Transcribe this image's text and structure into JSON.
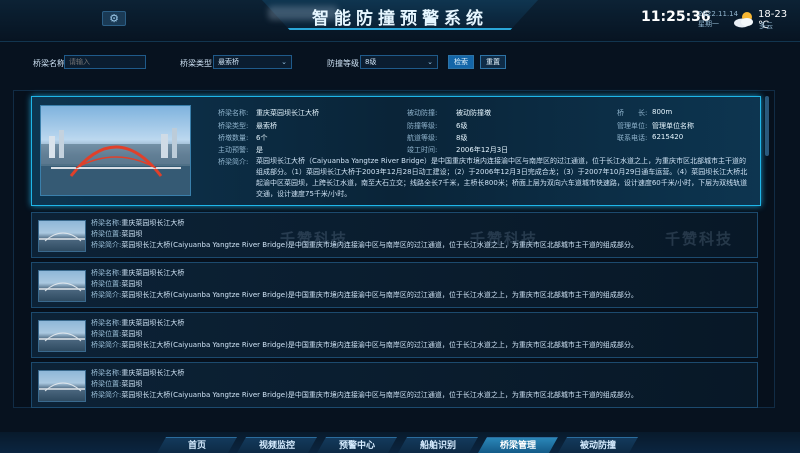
{
  "header": {
    "title": "智能防撞预警系统",
    "time": "11:25:36",
    "date": "2022.11.14",
    "weekday": "星期一",
    "temperature": "18-23 ℃",
    "weather": "多云",
    "settings_icon": "gear-icon",
    "weather_icon": "cloudy-sun-icon"
  },
  "search": {
    "name_label": "桥梁名称",
    "name_placeholder": "请输入",
    "type_label": "桥梁类型",
    "type_value": "悬索桥",
    "level_label": "防撞等级",
    "level_value": "8级",
    "search_button": "检索",
    "reset_button": "重置"
  },
  "featured": {
    "name_label": "桥梁名称:",
    "name": "重庆菜园坝长江大桥",
    "type_label": "桥梁类型:",
    "type": "悬索桥",
    "piers_label": "桥墩数量:",
    "piers": "6个",
    "alert_label": "主动预警:",
    "alert": "是",
    "defense_label": "被动防撞:",
    "defense": "被动防撞墩",
    "level_label": "防撞等级:",
    "level": "6级",
    "channel_label": "航道等级:",
    "channel": "8级",
    "completed_label": "竣工时间:",
    "completed": "2006年12月3日",
    "length_label": "桥　　长:",
    "length": "800m",
    "unit_label": "管理单位:",
    "unit": "管理单位名称",
    "phone_label": "联系电话:",
    "phone": "6215420",
    "intro_label": "桥梁简介:",
    "intro": "菜园坝长江大桥（Caiyuanba Yangtze River Bridge）是中国重庆市境内连接渝中区与南岸区的过江通道，位于长江水道之上，为重庆市区北部城市主干道的组成部分。（1）菜园坝长江大桥于2003年12月28日动工建设；（2）于2006年12月3日完成合龙；（3）于2007年10月29日通车运营。（4）菜园坝长江大桥北起渝中区菜园坝，上跨长江水道，南至大石立交；线路全长7千米，主桥长800米；桥面上层为双向六车道城市快速路，设计速度60千米/小时，下层为双线轨道交通，设计速度75千米/小时。"
  },
  "rows": [
    {
      "name_label": "桥梁名称:",
      "name": "重庆菜园坝长江大桥",
      "location_label": "桥梁位置:",
      "location": "菜园坝",
      "intro_label": "桥梁简介:",
      "intro": "菜园坝长江大桥(Caiyuanba Yangtze River Bridge)是中国重庆市境内连接渝中区与南岸区的过江通道，位于长江水道之上，为重庆市区北部城市主干道的组成部分。"
    },
    {
      "name_label": "桥梁名称:",
      "name": "重庆菜园坝长江大桥",
      "location_label": "桥梁位置:",
      "location": "菜园坝",
      "intro_label": "桥梁简介:",
      "intro": "菜园坝长江大桥(Caiyuanba Yangtze River Bridge)是中国重庆市境内连接渝中区与南岸区的过江通道，位于长江水道之上，为重庆市区北部城市主干道的组成部分。"
    },
    {
      "name_label": "桥梁名称:",
      "name": "重庆菜园坝长江大桥",
      "location_label": "桥梁位置:",
      "location": "菜园坝",
      "intro_label": "桥梁简介:",
      "intro": "菜园坝长江大桥(Caiyuanba Yangtze River Bridge)是中国重庆市境内连接渝中区与南岸区的过江通道，位于长江水道之上，为重庆市区北部城市主干道的组成部分。"
    },
    {
      "name_label": "桥梁名称:",
      "name": "重庆菜园坝长江大桥",
      "location_label": "桥梁位置:",
      "location": "菜园坝",
      "intro_label": "桥梁简介:",
      "intro": "菜园坝长江大桥(Caiyuanba Yangtze River Bridge)是中国重庆市境内连接渝中区与南岸区的过江通道，位于长江水道之上，为重庆市区北部城市主干道的组成部分。"
    }
  ],
  "watermark": "千赞科技",
  "nav": {
    "tabs": [
      "首页",
      "视频监控",
      "预警中心",
      "船舶识别",
      "桥梁管理",
      "被动防撞"
    ],
    "active": "桥梁管理"
  }
}
